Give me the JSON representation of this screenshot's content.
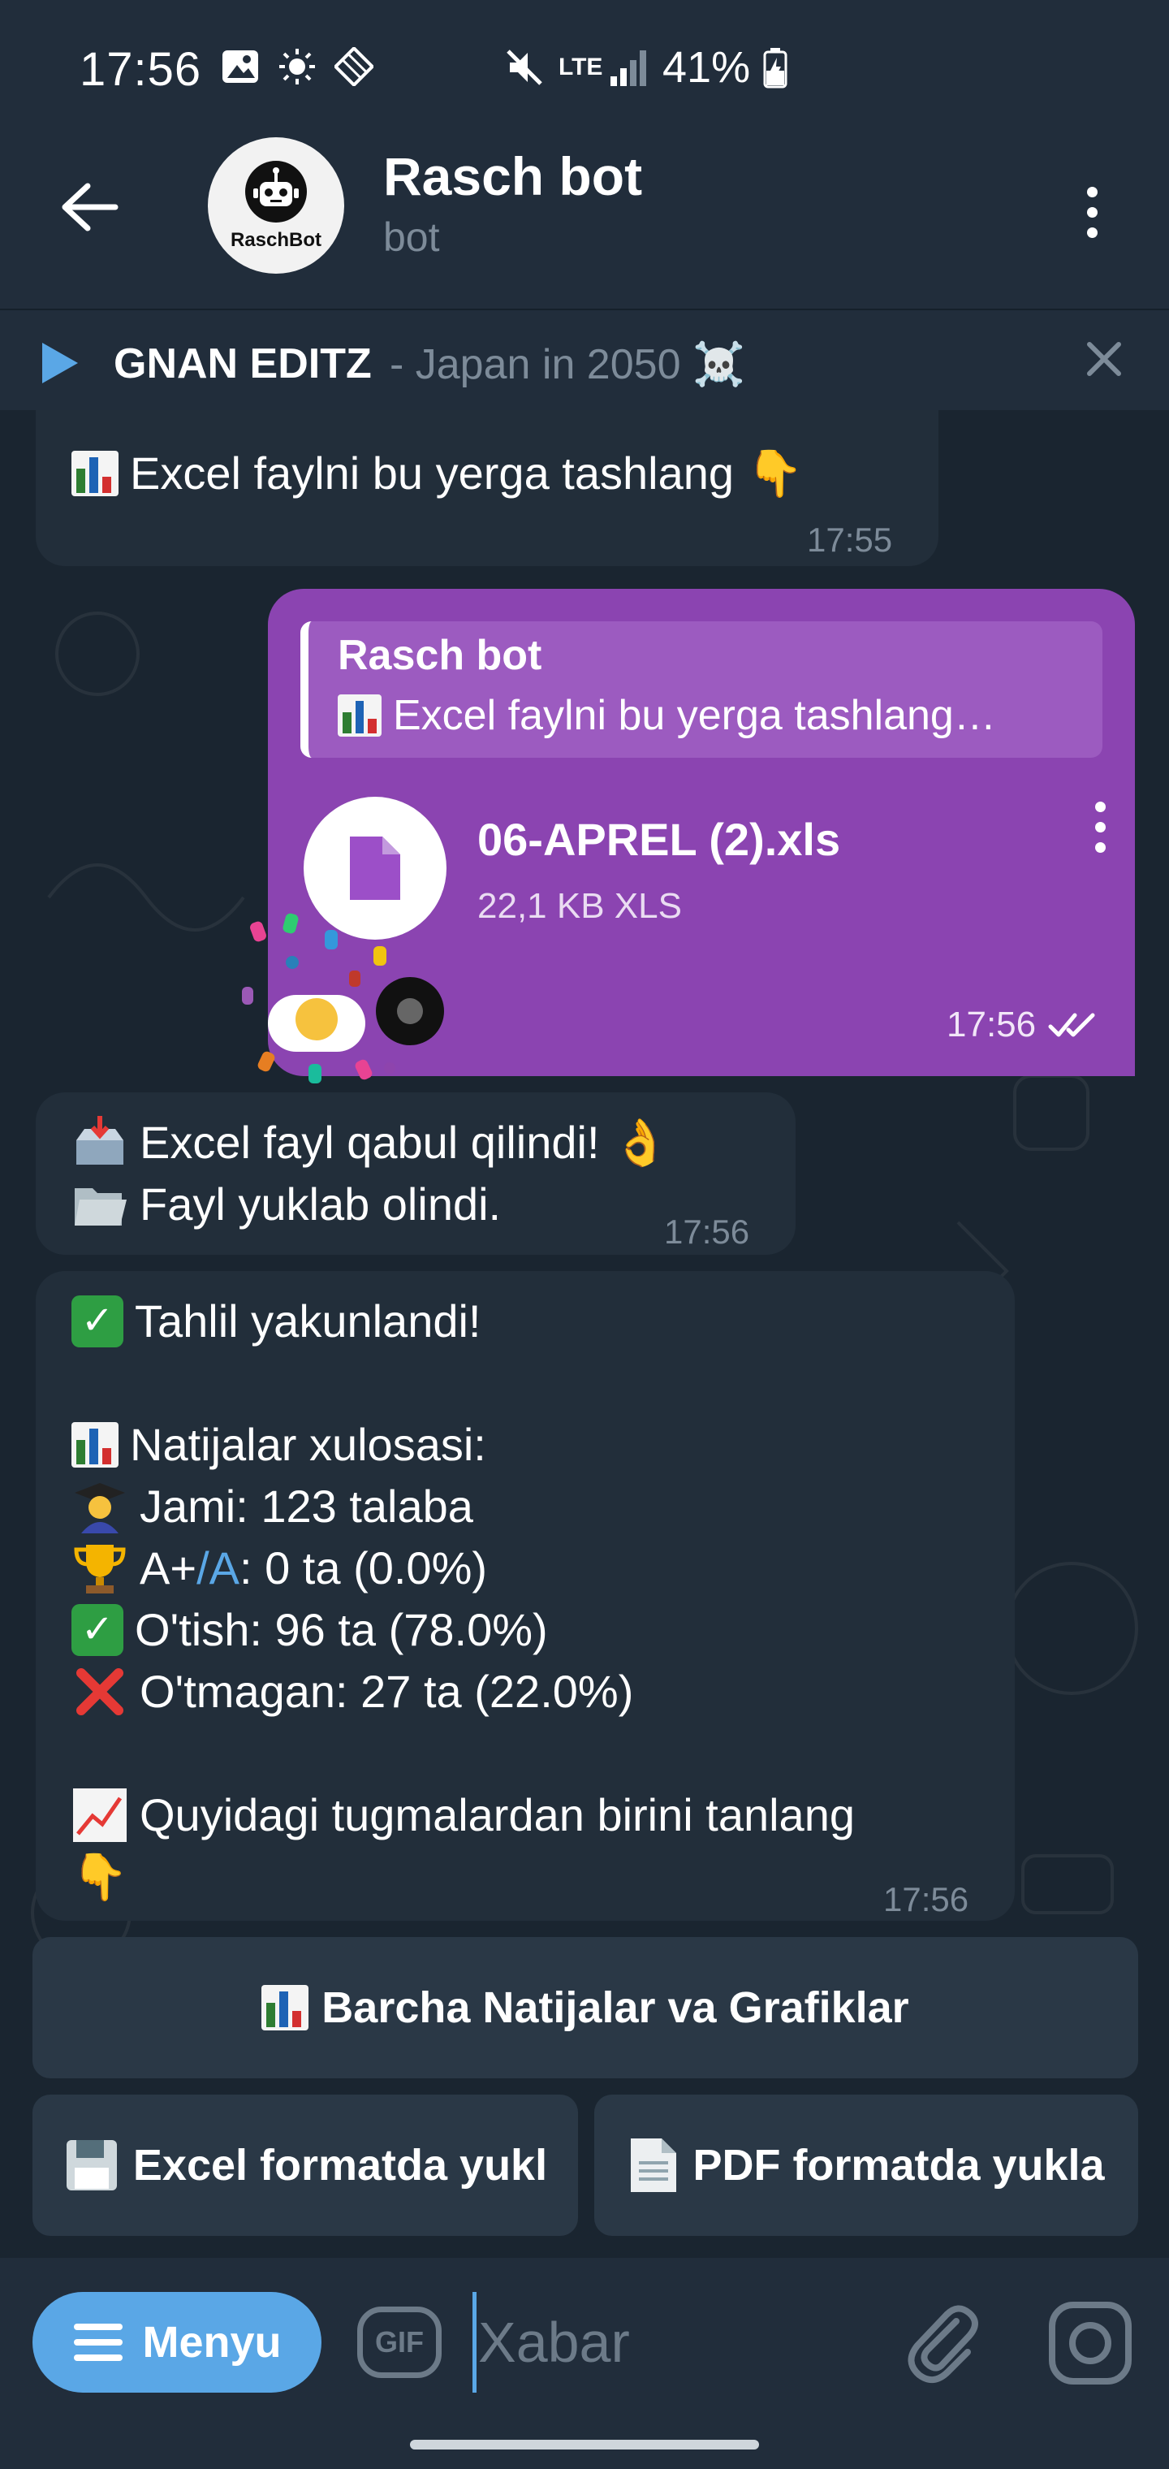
{
  "status_bar": {
    "time": "17:56",
    "network": "LTE",
    "battery": "41%"
  },
  "header": {
    "title": "Rasch bot",
    "subtitle": "bot",
    "avatar_label": "RaschBot"
  },
  "music_bar": {
    "artist": "GNAN EDITZ",
    "title": "- Japan in 2050 ☠️"
  },
  "messages": {
    "m1": {
      "text": "Excel faylni bu yerga tashlang 👇",
      "time": "17:55"
    },
    "m2": {
      "reply_name": "Rasch bot",
      "reply_text": "Excel faylni bu yerga tashlang…",
      "file_name": "06-APREL (2).xls",
      "file_size": "22,1 KB XLS",
      "time": "17:56"
    },
    "m3": {
      "line1": "Excel fayl qabul qilindi! 👌",
      "line2": "Fayl yuklab olindi.",
      "time": "17:56"
    },
    "m4": {
      "line1": "Tahlil yakunlandi!",
      "line2": "Natijalar xulosasi:",
      "line3": "Jami: 123 talaba",
      "line4_prefix": "A+",
      "line4_link": "/A",
      "line4_suffix": ": 0 ta (0.0%)",
      "line5": "O'tish: 96 ta (78.0%)",
      "line6": "O'tmagan: 27 ta (22.0%)",
      "line7": "Quyidagi tugmalardan birini tanlang",
      "line8": "👇",
      "time": "17:56"
    }
  },
  "keyboard": {
    "btn_all": "Barcha Natijalar va Grafiklar",
    "btn_excel": "Excel formatda yukl",
    "btn_pdf": "PDF formatda yukla"
  },
  "input_bar": {
    "menu_label": "Menyu",
    "gif_label": "GIF",
    "placeholder": "Xabar"
  },
  "colors": {
    "accent": "#5aa7e6",
    "outgoing_bubble": "#8b44b1",
    "incoming_bubble": "#222e3a",
    "background": "#1a2530"
  }
}
